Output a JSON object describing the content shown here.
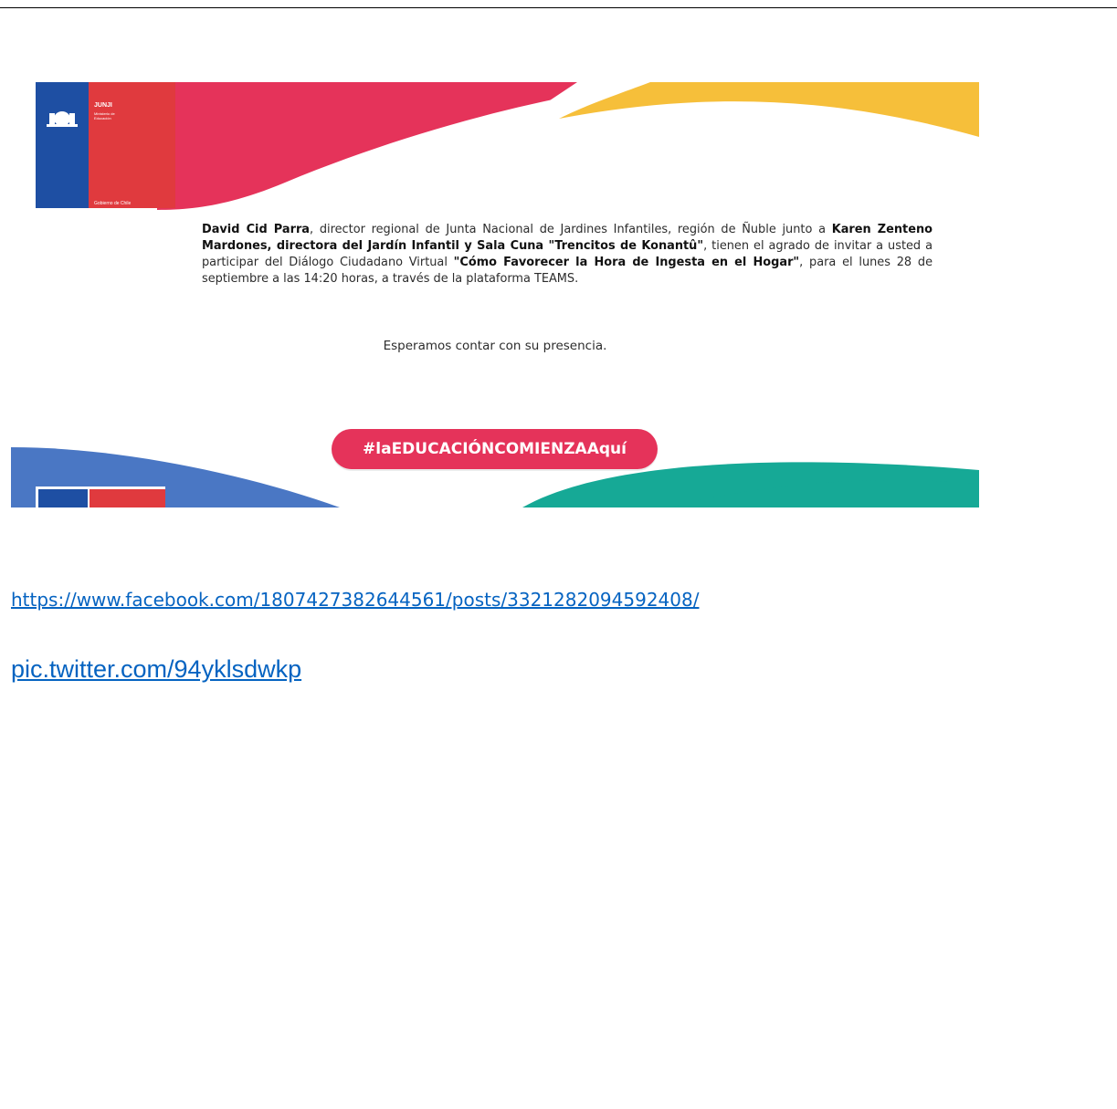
{
  "invitation": {
    "logo": {
      "agency": "JUNJI",
      "ministry": "Ministerio de Educación",
      "government": "Gobierno de Chile"
    },
    "paragraph": {
      "host_name": "David Cid Parra",
      "host_role": ", director regional de Junta Nacional de Jardines Infantiles, región de Ñuble junto a ",
      "cohost": "Karen Zenteno Mardones, directora del Jardín Infantil y Sala Cuna \"Trencitos de Konantû\"",
      "invite_text": ", tienen el agrado de invitar a usted a participar del Diálogo Ciudadano Virtual ",
      "event_title": "\"Cómo Favorecer la Hora de Ingesta en el Hogar\"",
      "event_details": ", para el lunes 28 de septiembre a las 14:20 horas, a través de la plataforma TEAMS."
    },
    "closing": "Esperamos contar con su presencia.",
    "hashtag": "#laEDUCACIÓNCOMIENZAAquí",
    "colors": {
      "pink": "#e5335a",
      "yellow": "#f6bf3a",
      "blue": "#4a77c4",
      "teal": "#16a996",
      "gov_blue": "#1e4fa3",
      "gov_red": "#e03a3e"
    }
  },
  "links": {
    "facebook": "https://www.facebook.com/1807427382644561/posts/3321282094592408/",
    "twitter": "pic.twitter.com/94yklsdwkp"
  }
}
